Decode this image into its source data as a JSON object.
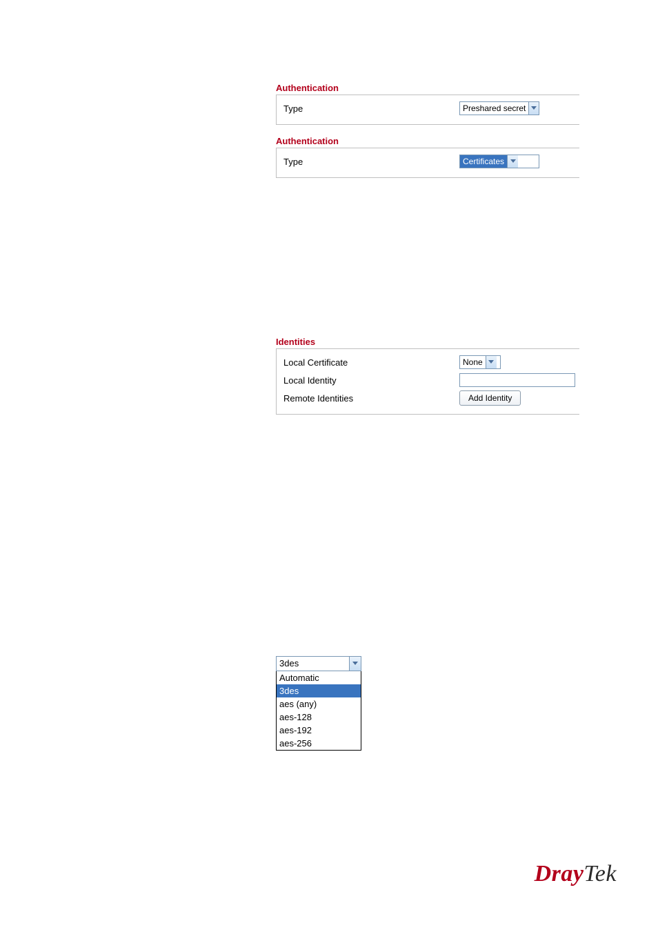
{
  "auth1": {
    "heading": "Authentication",
    "type_label": "Type",
    "type_value": "Preshared secret"
  },
  "auth2": {
    "heading": "Authentication",
    "type_label": "Type",
    "type_value": "Certificates"
  },
  "identities": {
    "heading": "Identities",
    "local_cert_label": "Local Certificate",
    "local_cert_value": "None",
    "local_identity_label": "Local Identity",
    "local_identity_value": "",
    "remote_label": "Remote Identities",
    "add_button": "Add Identity"
  },
  "enc_dropdown": {
    "selected": "3des",
    "options": [
      "Automatic",
      "3des",
      "aes (any)",
      "aes-128",
      "aes-192",
      "aes-256"
    ]
  },
  "brand": {
    "part1": "Dray",
    "part2": "Tek"
  }
}
